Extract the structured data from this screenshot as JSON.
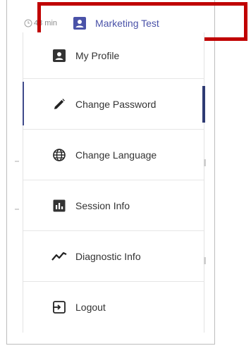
{
  "topbar": {
    "timer_text": "48 min",
    "user_name": "Marketing Test"
  },
  "menu": {
    "items": [
      {
        "label": "My Profile"
      },
      {
        "label": "Change Password"
      },
      {
        "label": "Change Language"
      },
      {
        "label": "Session Info"
      },
      {
        "label": "Diagnostic Info"
      },
      {
        "label": "Logout"
      }
    ]
  },
  "colors": {
    "accent": "#4a52a8",
    "highlight": "#c00000",
    "active_indicator": "#2f3b73"
  }
}
